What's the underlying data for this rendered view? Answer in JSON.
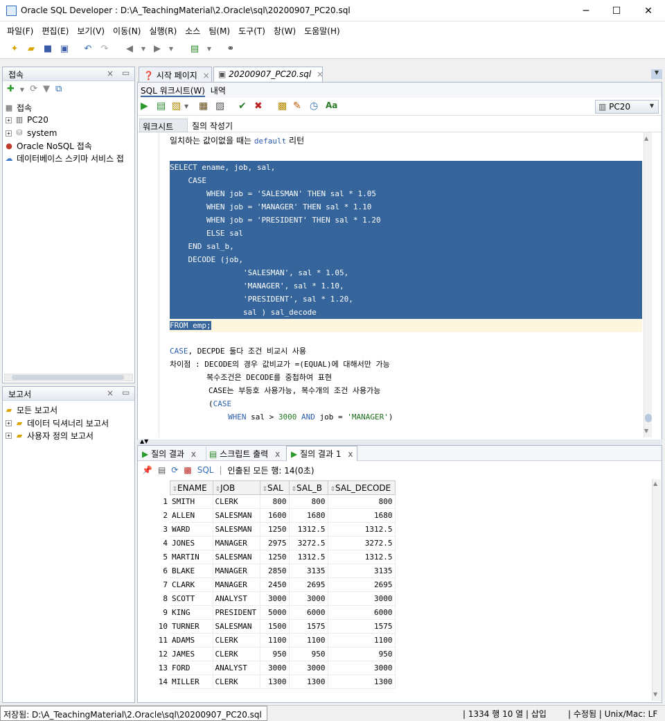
{
  "window": {
    "title": "Oracle SQL Developer : D:\\A_TeachingMaterial\\2.Oracle\\sql\\20200907_PC20.sql",
    "minimize": "─",
    "maximize": "☐",
    "close": "✕"
  },
  "menu": [
    "파일(F)",
    "편집(E)",
    "보기(V)",
    "이동(N)",
    "실행(R)",
    "소스",
    "팀(M)",
    "도구(T)",
    "창(W)",
    "도움말(H)"
  ],
  "connections": {
    "title": "접속",
    "root": "접속",
    "items": [
      "PC20",
      "system"
    ],
    "nosql": "Oracle NoSQL 접속",
    "schema": "데이터베이스 스키마 서비스 접"
  },
  "reports": {
    "title": "보고서",
    "items": [
      "모든 보고서",
      "데이터 딕셔너리 보고서",
      "사용자 정의 보고서"
    ]
  },
  "editor_tabs": [
    "시작 페이지",
    "20200907_PC20.sql"
  ],
  "subtabs": [
    "SQL 워크시트(W)",
    "내역"
  ],
  "connection_select": "PC20",
  "worksheet_tabs": [
    "워크시트",
    "질의 작성기"
  ],
  "code": {
    "line0": [
      "일치하는 값이없을 때는 ",
      "default",
      " 리턴"
    ],
    "sel": [
      "SELECT ename, job, sal,",
      "    CASE",
      "        WHEN job = 'SALESMAN' THEN sal * 1.05",
      "        WHEN job = 'MANAGER' THEN sal * 1.10",
      "        WHEN job = 'PRESIDENT' THEN sal * 1.20",
      "        ELSE sal",
      "    END sal_b,",
      "    DECODE (job,",
      "                'SALESMAN', sal * 1.05,",
      "                'MANAGER', sal * 1.10,",
      "                'PRESIDENT', sal * 1.20,",
      "                sal ) sal_decode"
    ],
    "from": "FROM emp;",
    "c1": [
      "CASE",
      ", DECPDE 둘다 조건 비교시 사용"
    ],
    "c2": [
      "차이점 : DECODE의 경우 값비교가 =(EQUAL)에 대해서만 가능"
    ],
    "c3": [
      "        복수조건은 DECODE를 중첩하여 표현"
    ],
    "c4": [
      "CASE는 부등호 사용가능, 복수개의 조건 사용가능"
    ],
    "c5": [
      "(",
      "CASE"
    ],
    "c6": [
      "WHEN",
      " sal > ",
      "3000",
      " AND",
      " job = ",
      "'MANAGER'",
      ")"
    ]
  },
  "result_tabs": [
    "질의 결과",
    "스크립트 출력",
    "질의 결과 1"
  ],
  "result_toolbar": {
    "sql": "SQL",
    "status": "인출된 모든 행: 14(0초)"
  },
  "columns": [
    "ENAME",
    "JOB",
    "SAL",
    "SAL_B",
    "SAL_DECODE"
  ],
  "rows": [
    [
      "1",
      "SMITH",
      "CLERK",
      "800",
      "800",
      "800"
    ],
    [
      "2",
      "ALLEN",
      "SALESMAN",
      "1600",
      "1680",
      "1680"
    ],
    [
      "3",
      "WARD",
      "SALESMAN",
      "1250",
      "1312.5",
      "1312.5"
    ],
    [
      "4",
      "JONES",
      "MANAGER",
      "2975",
      "3272.5",
      "3272.5"
    ],
    [
      "5",
      "MARTIN",
      "SALESMAN",
      "1250",
      "1312.5",
      "1312.5"
    ],
    [
      "6",
      "BLAKE",
      "MANAGER",
      "2850",
      "3135",
      "3135"
    ],
    [
      "7",
      "CLARK",
      "MANAGER",
      "2450",
      "2695",
      "2695"
    ],
    [
      "8",
      "SCOTT",
      "ANALYST",
      "3000",
      "3000",
      "3000"
    ],
    [
      "9",
      "KING",
      "PRESIDENT",
      "5000",
      "6000",
      "6000"
    ],
    [
      "10",
      "TURNER",
      "SALESMAN",
      "1500",
      "1575",
      "1575"
    ],
    [
      "11",
      "ADAMS",
      "CLERK",
      "1100",
      "1100",
      "1100"
    ],
    [
      "12",
      "JAMES",
      "CLERK",
      "950",
      "950",
      "950"
    ],
    [
      "13",
      "FORD",
      "ANALYST",
      "3000",
      "3000",
      "3000"
    ],
    [
      "14",
      "MILLER",
      "CLERK",
      "1300",
      "1300",
      "1300"
    ]
  ],
  "status": {
    "file": "저장됨: D:\\A_TeachingMaterial\\2.Oracle\\sql\\20200907_PC20.sql",
    "pos": "1334 행 10 열",
    "ins": "삽입",
    "mod": "수정됨",
    "eol": "Unix/Mac: LF"
  }
}
